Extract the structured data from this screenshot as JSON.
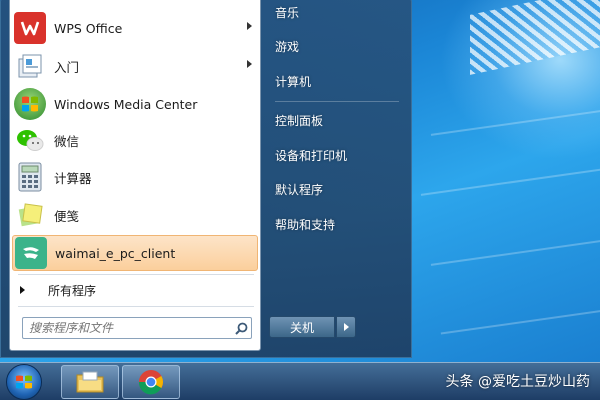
{
  "left_menu": {
    "items": [
      {
        "label": "WPS Office",
        "icon": "wps-office-icon",
        "has_submenu": true
      },
      {
        "label": "入门",
        "icon": "getting-started-icon",
        "has_submenu": true
      },
      {
        "label": "Windows Media Center",
        "icon": "windows-media-center-icon",
        "has_submenu": false
      },
      {
        "label": "微信",
        "icon": "wechat-icon",
        "has_submenu": false
      },
      {
        "label": "计算器",
        "icon": "calculator-icon",
        "has_submenu": false
      },
      {
        "label": "便笺",
        "icon": "sticky-notes-icon",
        "has_submenu": false
      },
      {
        "label": "waimai_e_pc_client",
        "icon": "waimai-client-icon",
        "has_submenu": false,
        "highlighted": true
      }
    ],
    "all_programs": "所有程序",
    "search_placeholder": "搜索程序和文件"
  },
  "right_menu": {
    "items": [
      "音乐",
      "游戏",
      "计算机",
      "控制面板",
      "设备和打印机",
      "默认程序",
      "帮助和支持"
    ],
    "shutdown_label": "关机"
  },
  "taskbar": {
    "pinned": [
      "file-explorer-icon",
      "chrome-icon"
    ]
  },
  "watermark": "头条 @爱吃土豆炒山药",
  "colors": {
    "highlight": "#fbcf9c",
    "wps_red": "#d9322b",
    "wechat_green": "#2dc100"
  }
}
